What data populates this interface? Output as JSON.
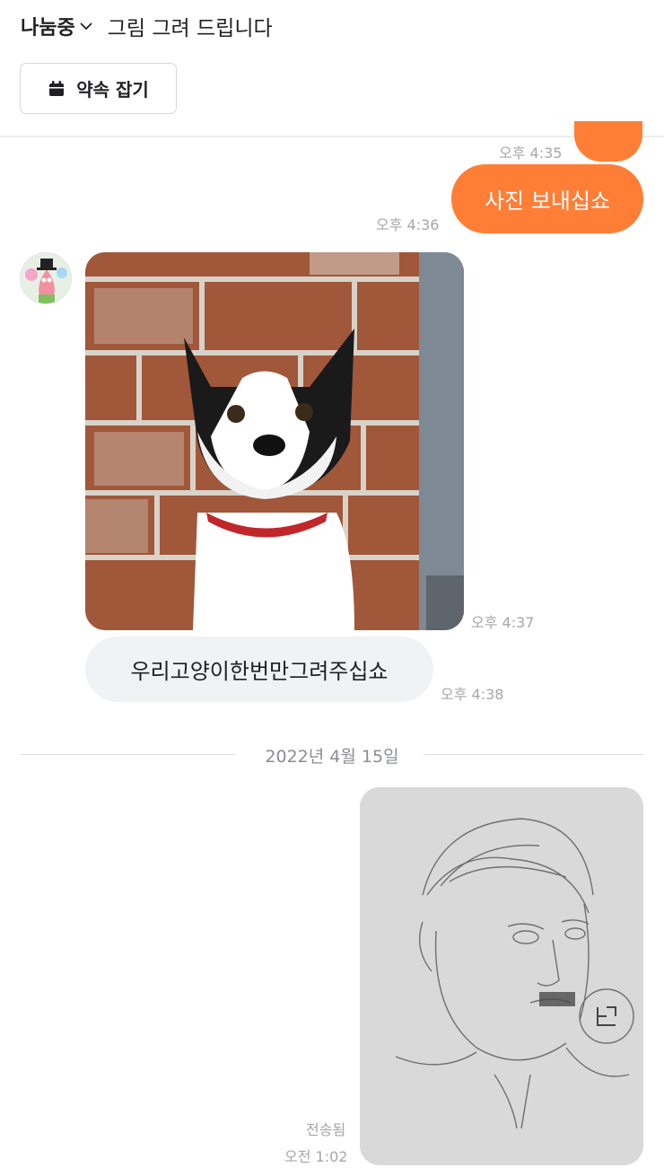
{
  "header": {
    "status": "나눔중",
    "title": "그림 그려 드립니다",
    "appointment_button": "약속 잡기"
  },
  "messages": [
    {
      "id": "m0",
      "direction": "out",
      "type": "text",
      "text": "",
      "time": "오후 4:35"
    },
    {
      "id": "m1",
      "direction": "out",
      "type": "text",
      "text": "사진 보내십쇼",
      "time": "오후 4:36"
    },
    {
      "id": "m2",
      "direction": "in",
      "type": "image",
      "subject": "black and white cat in front of brick wall",
      "time": "오후 4:37"
    },
    {
      "id": "m3",
      "direction": "in",
      "type": "text",
      "text": "우리고양이한번만그려주십쇼",
      "time": "오후 4:38"
    },
    {
      "id": "m4",
      "direction": "out",
      "type": "image",
      "subject": "pencil sketch portrait",
      "status": "전송됨",
      "time": "오전 1:02"
    }
  ],
  "date_divider": "2022년 4월 15일",
  "colors": {
    "accent": "#ff7e36",
    "incoming_bubble": "#f1f2f4",
    "timestamp": "#a5a7aa",
    "text": "#212124"
  },
  "icons": {
    "status_dropdown": "chevron-down-icon",
    "appointment": "calendar-icon"
  }
}
